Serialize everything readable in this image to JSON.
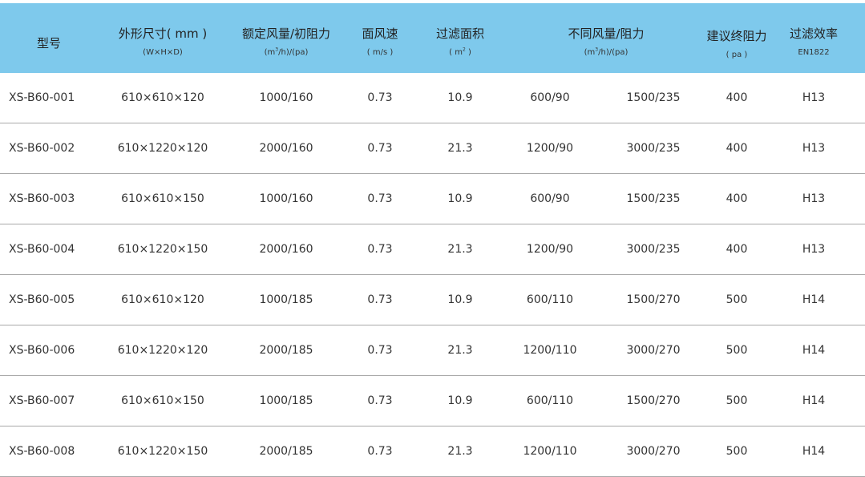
{
  "headers": [
    {
      "key": "model",
      "title": "型号",
      "sub": ""
    },
    {
      "key": "size",
      "title": "外形尺寸( mm )",
      "sub": "(W×H×D)"
    },
    {
      "key": "rated",
      "title": "额定风量/初阻力",
      "sub_pre": "(m",
      "sub_sup": "3",
      "sub_post": "/h)/(pa)"
    },
    {
      "key": "velocity",
      "title": "面风速",
      "sub": "( m/s )"
    },
    {
      "key": "area",
      "title": "过滤面积",
      "sub_pre": "( m",
      "sub_sup": "2",
      "sub_post": " )"
    },
    {
      "key": "diff",
      "title": "不同风量/阻力",
      "sub_pre": "(m",
      "sub_sup": "3",
      "sub_post": "/h)/(pa)"
    },
    {
      "key": "final",
      "title": "建议终阻力",
      "sub": "( pa )"
    },
    {
      "key": "eff",
      "title": "过滤效率",
      "sub": "EN1822"
    }
  ],
  "rows": [
    [
      "XS-B60-001",
      "610×610×120",
      "1000/160",
      "0.73",
      "10.9",
      "600/90",
      "1500/235",
      "400",
      "H13"
    ],
    [
      "XS-B60-002",
      "610×1220×120",
      "2000/160",
      "0.73",
      "21.3",
      "1200/90",
      "3000/235",
      "400",
      "H13"
    ],
    [
      "XS-B60-003",
      "610×610×150",
      "1000/160",
      "0.73",
      "10.9",
      "600/90",
      "1500/235",
      "400",
      "H13"
    ],
    [
      "XS-B60-004",
      "610×1220×150",
      "2000/160",
      "0.73",
      "21.3",
      "1200/90",
      "3000/235",
      "400",
      "H13"
    ],
    [
      "XS-B60-005",
      "610×610×120",
      "1000/185",
      "0.73",
      "10.9",
      "600/110",
      "1500/270",
      "500",
      "H14"
    ],
    [
      "XS-B60-006",
      "610×1220×120",
      "2000/185",
      "0.73",
      "21.3",
      "1200/110",
      "3000/270",
      "500",
      "H14"
    ],
    [
      "XS-B60-007",
      "610×610×150",
      "1000/185",
      "0.73",
      "10.9",
      "600/110",
      "1500/270",
      "500",
      "H14"
    ],
    [
      "XS-B60-008",
      "610×1220×150",
      "2000/185",
      "0.73",
      "21.3",
      "1200/110",
      "3000/270",
      "500",
      "H14"
    ]
  ],
  "colors": {
    "header_bg": "#7ec9ec",
    "row_divider": "#a9a9a9",
    "text": "#333333"
  }
}
